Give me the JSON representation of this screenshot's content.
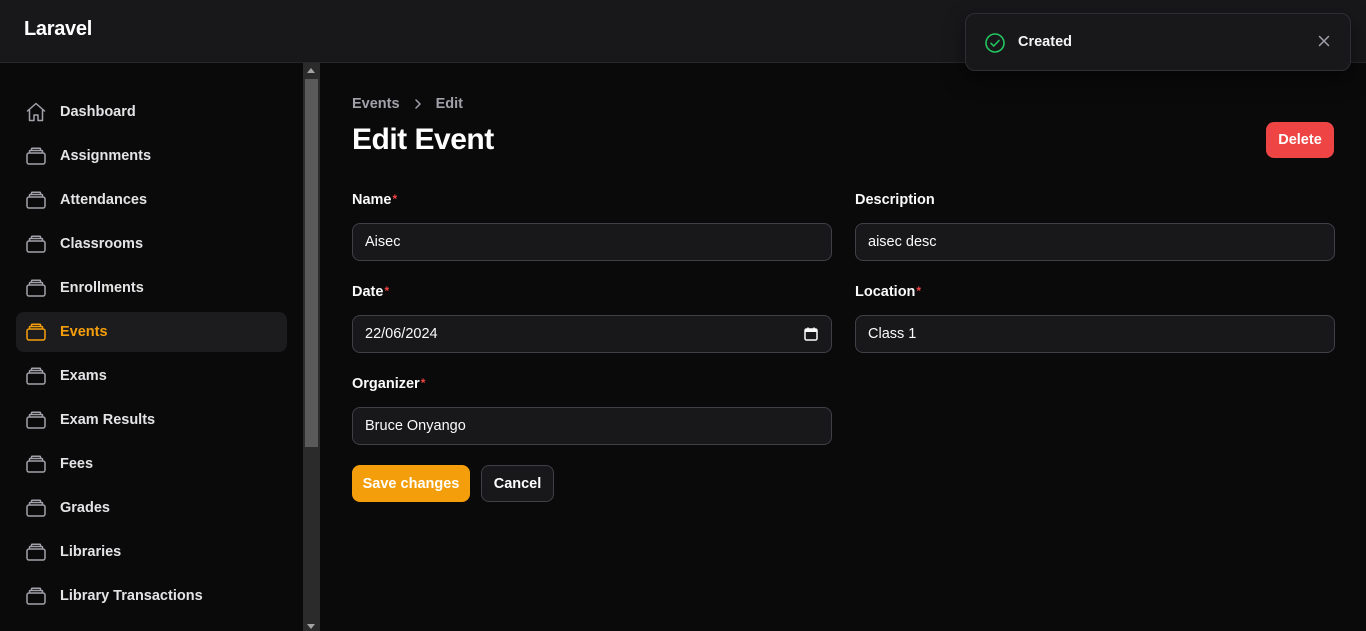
{
  "app": {
    "brand": "Laravel"
  },
  "colors": {
    "accent": "#f59e0b",
    "danger": "#ef4444",
    "success": "#22c55e"
  },
  "sidebar": {
    "items": [
      {
        "label": "Dashboard",
        "icon": "home-icon",
        "active": false
      },
      {
        "label": "Assignments",
        "icon": "stack-icon",
        "active": false
      },
      {
        "label": "Attendances",
        "icon": "stack-icon",
        "active": false
      },
      {
        "label": "Classrooms",
        "icon": "stack-icon",
        "active": false
      },
      {
        "label": "Enrollments",
        "icon": "stack-icon",
        "active": false
      },
      {
        "label": "Events",
        "icon": "stack-icon",
        "active": true
      },
      {
        "label": "Exams",
        "icon": "stack-icon",
        "active": false
      },
      {
        "label": "Exam Results",
        "icon": "stack-icon",
        "active": false
      },
      {
        "label": "Fees",
        "icon": "stack-icon",
        "active": false
      },
      {
        "label": "Grades",
        "icon": "stack-icon",
        "active": false
      },
      {
        "label": "Libraries",
        "icon": "stack-icon",
        "active": false
      },
      {
        "label": "Library Transactions",
        "icon": "stack-icon",
        "active": false
      }
    ]
  },
  "breadcrumb": {
    "parent": "Events",
    "current": "Edit"
  },
  "page": {
    "title": "Edit Event",
    "delete_label": "Delete"
  },
  "form": {
    "name": {
      "label": "Name",
      "value": "Aisec",
      "required": true
    },
    "description": {
      "label": "Description",
      "value": "aisec desc",
      "required": false
    },
    "date": {
      "label": "Date",
      "value": "22/06/2024",
      "required": true
    },
    "location": {
      "label": "Location",
      "value": "Class 1",
      "required": true
    },
    "organizer": {
      "label": "Organizer",
      "value": "Bruce Onyango",
      "required": true
    },
    "save_label": "Save changes",
    "cancel_label": "Cancel"
  },
  "toast": {
    "message": "Created",
    "icon": "check-circle-icon"
  }
}
